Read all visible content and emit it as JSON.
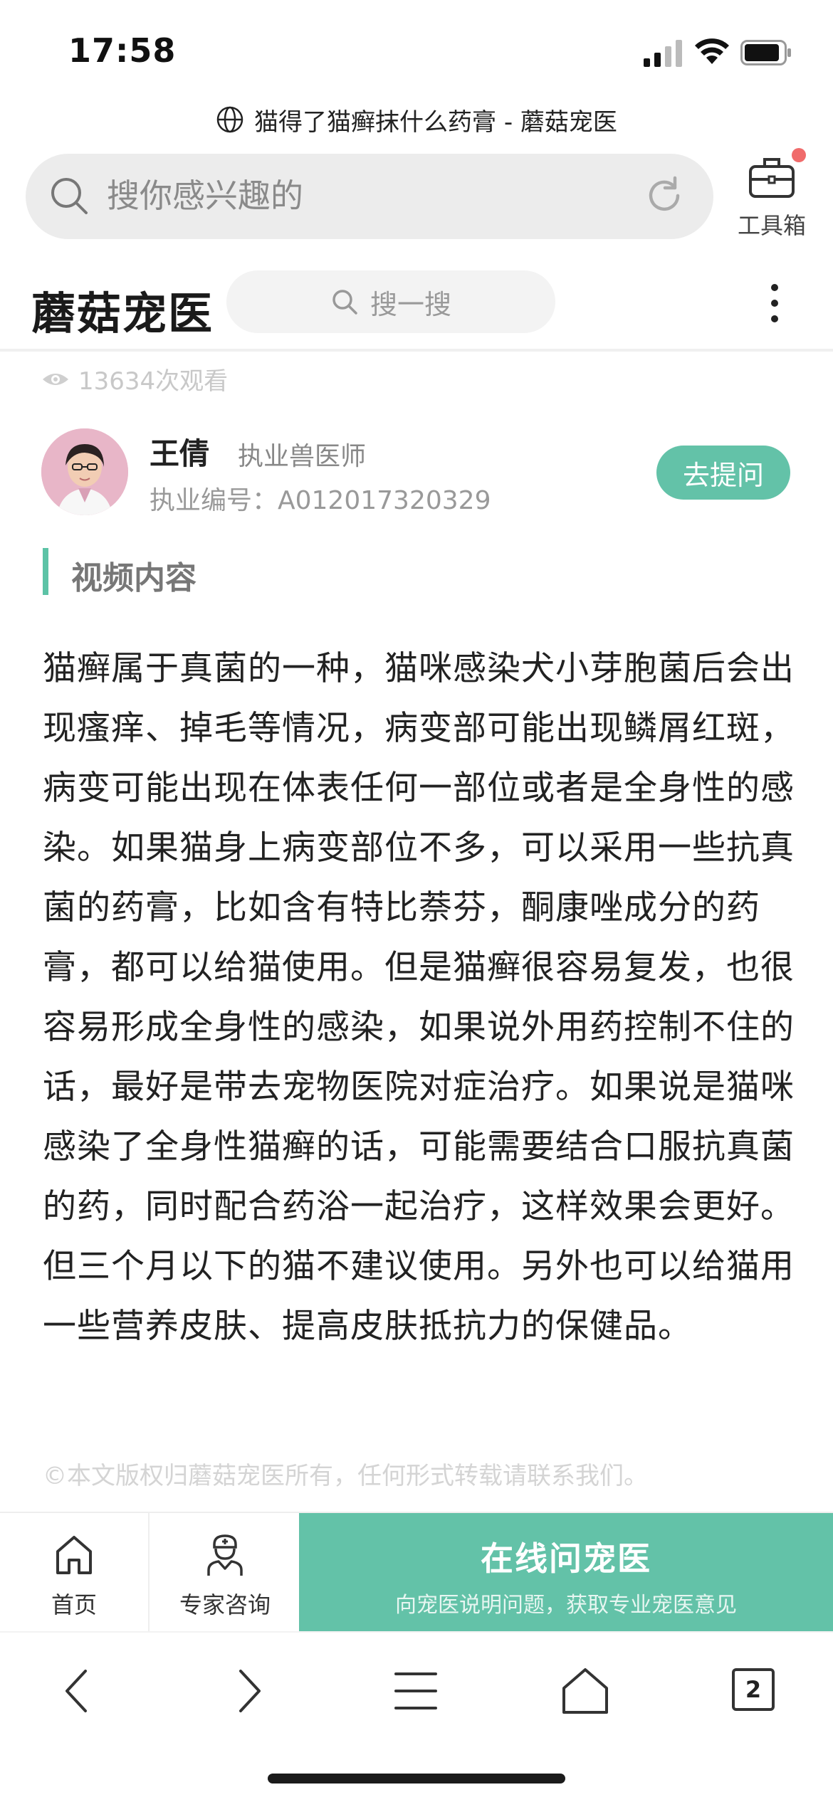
{
  "status_bar": {
    "time": "17:58"
  },
  "browser": {
    "page_title": "猫得了猫癣抹什么药膏 - 蘑菇宠医",
    "search_placeholder": "搜你感兴趣的",
    "toolbox_label": "工具箱"
  },
  "site_header": {
    "logo_text": "蘑菇宠医",
    "search_placeholder": "搜一搜"
  },
  "article": {
    "views": "13634次观看",
    "doctor": {
      "name": "王倩",
      "title": "执业兽医师",
      "license": "执业编号：A012017320329"
    },
    "ask_button": "去提问",
    "section_title": "视频内容",
    "body": "猫癣属于真菌的一种，猫咪感染犬小芽胞菌后会出现瘙痒、掉毛等情况，病变部可能出现鳞屑红斑，病变可能出现在体表任何一部位或者是全身性的感染。如果猫身上病变部位不多，可以采用一些抗真菌的药膏，比如含有特比萘芬，酮康唑成分的药膏，都可以给猫使用。但是猫癣很容易复发，也很容易形成全身性的感染，如果说外用药控制不住的话，最好是带去宠物医院对症治疗。如果说是猫咪感染了全身性猫癣的话，可能需要结合口服抗真菌的药，同时配合药浴一起治疗，这样效果会更好。但三个月以下的猫不建议使用。另外也可以给猫用一些营养皮肤、提高皮肤抵抗力的保健品。",
    "copyright": "©本文版权归蘑菇宠医所有，任何形式转载请联系我们。"
  },
  "bottom_bar": {
    "home_label": "首页",
    "expert_label": "专家咨询",
    "cta_title": "在线问宠医",
    "cta_subtitle": "向宠医说明问题，获取专业宠医意见"
  },
  "browser_nav": {
    "tab_count": "2"
  },
  "colors": {
    "accent": "#63c2a8",
    "badge": "#f06b6b"
  }
}
